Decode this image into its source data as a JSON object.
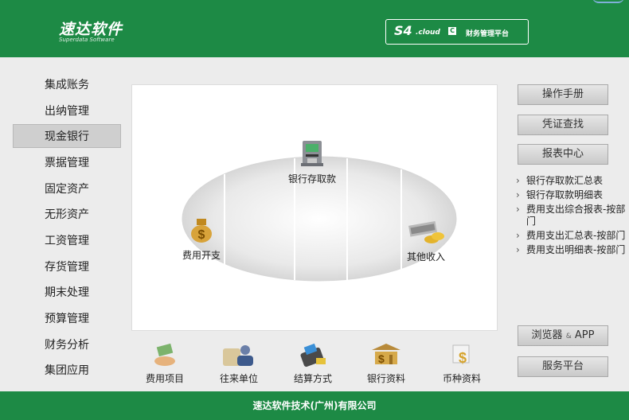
{
  "header": {
    "logo_title": "速达软件",
    "logo_subtitle": "Superdata Software",
    "platform_s4": "S4",
    "platform_cloud": ".cloud",
    "platform_badge": "C",
    "platform_text": "财务管理平台"
  },
  "sidebar": {
    "items": [
      {
        "label": "集成账务",
        "active": false
      },
      {
        "label": "出纳管理",
        "active": false
      },
      {
        "label": "现金银行",
        "active": true
      },
      {
        "label": "票据管理",
        "active": false
      },
      {
        "label": "固定资产",
        "active": false
      },
      {
        "label": "无形资产",
        "active": false
      },
      {
        "label": "工资管理",
        "active": false
      },
      {
        "label": "存货管理",
        "active": false
      },
      {
        "label": "期末处理",
        "active": false
      },
      {
        "label": "预算管理",
        "active": false
      },
      {
        "label": "财务分析",
        "active": false
      },
      {
        "label": "集团应用",
        "active": false
      }
    ]
  },
  "flow": {
    "bank_deposit": "银行存取款",
    "expense": "费用开支",
    "other_income": "其他收入"
  },
  "bottom": {
    "items": [
      "费用项目",
      "往来单位",
      "结算方式",
      "银行资料",
      "币种资料"
    ]
  },
  "right": {
    "manual": "操作手册",
    "voucher_search": "凭证查找",
    "report_center": "报表中心",
    "reports": [
      "银行存取款汇总表",
      "银行存取款明细表",
      "费用支出综合报表-按部门",
      "费用支出汇总表-按部门",
      "费用支出明细表-按部门"
    ],
    "browser_main": "浏览器",
    "browser_amp": "&",
    "browser_app": "APP",
    "service_platform": "服务平台"
  },
  "footer": {
    "text": "速达软件技术(广州)有限公司"
  },
  "colors": {
    "brand_green": "#1d8a45",
    "active_bg": "#cfcfcf",
    "panel_bg": "#ececec"
  }
}
